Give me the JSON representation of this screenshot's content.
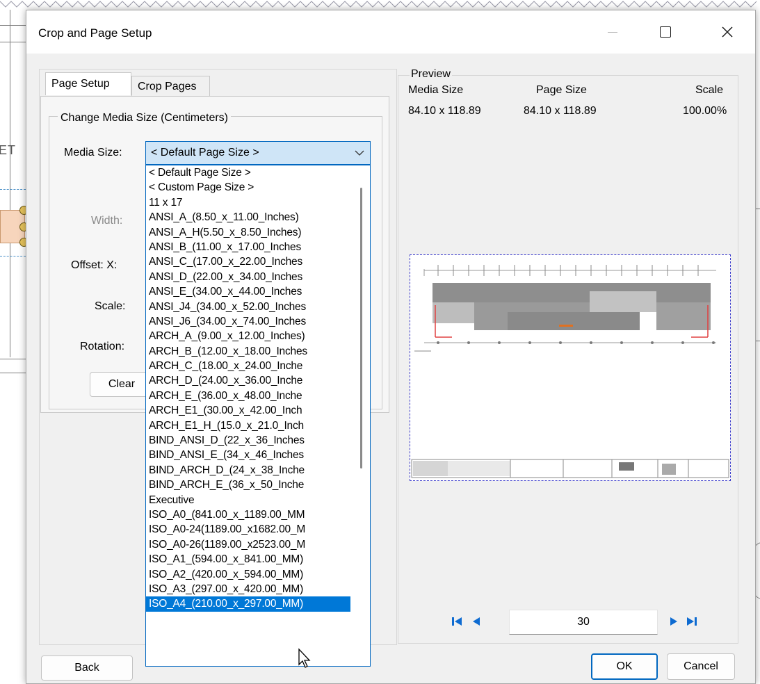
{
  "dialog": {
    "title": "Crop and Page Setup"
  },
  "tabs": [
    {
      "label": "Page Setup",
      "active": true
    },
    {
      "label": "Crop Pages",
      "active": false
    }
  ],
  "page_setup": {
    "group_title": "Change Media Size (Centimeters)",
    "media_size_label": "Media Size:",
    "media_size_value": "< Default Page Size >",
    "width_label": "Width:",
    "offset_label": "Offset:  X:",
    "scale_label": "Scale:",
    "rotation_label": "Rotation:",
    "clear_label": "Clear"
  },
  "media_size_options": [
    "< Default Page Size >",
    "< Custom Page Size >",
    "11 x 17",
    "ANSI_A_(8.50_x_11.00_Inches)",
    "ANSI_A_H(5.50_x_8.50_Inches)",
    "ANSI_B_(11.00_x_17.00_Inches",
    "ANSI_C_(17.00_x_22.00_Inches",
    "ANSI_D_(22.00_x_34.00_Inches",
    "ANSI_E_(34.00_x_44.00_Inches",
    "ANSI_J4_(34.00_x_52.00_Inches",
    "ANSI_J6_(34.00_x_74.00_Inches",
    "ARCH_A_(9.00_x_12.00_Inches)",
    "ARCH_B_(12.00_x_18.00_Inches",
    "ARCH_C_(18.00_x_24.00_Inche",
    "ARCH_D_(24.00_x_36.00_Inche",
    "ARCH_E_(36.00_x_48.00_Inche",
    "ARCH_E1_(30.00_x_42.00_Inch",
    "ARCH_E1_H_(15.0_x_21.0_Inch",
    "BIND_ANSI_D_(22_x_36_Inches",
    "BIND_ANSI_E_(34_x_46_Inches",
    "BIND_ARCH_D_(24_x_38_Inche",
    "BIND_ARCH_E_(36_x_50_Inche",
    "Executive",
    "ISO_A0_(841.00_x_1189.00_MM",
    "ISO_A0-24(1189.00_x1682.00_M",
    "ISO_A0-26(1189.00_x2523.00_M",
    "ISO_A1_(594.00_x_841.00_MM)",
    "ISO_A2_(420.00_x_594.00_MM)",
    "ISO_A3_(297.00_x_420.00_MM)",
    "ISO_A4_(210.00_x_297.00_MM)"
  ],
  "media_size_highlighted": "ISO_A4_(210.00_x_297.00_MM)",
  "preview": {
    "legend": "Preview",
    "media_size_header": "Media Size",
    "page_size_header": "Page Size",
    "scale_header": "Scale",
    "media_size_value": "84.10 x 118.89",
    "page_size_value": "84.10 x 118.89",
    "scale_value": "100.00%",
    "page_number": "30"
  },
  "buttons": {
    "back": "Back",
    "ok": "OK",
    "cancel": "Cancel"
  },
  "background": {
    "partial_text": "ET"
  },
  "colors": {
    "accent": "#0067c0",
    "selection": "#0078d7",
    "nav_icon": "#0e6bd1",
    "preview_border": "#3a3acb"
  }
}
